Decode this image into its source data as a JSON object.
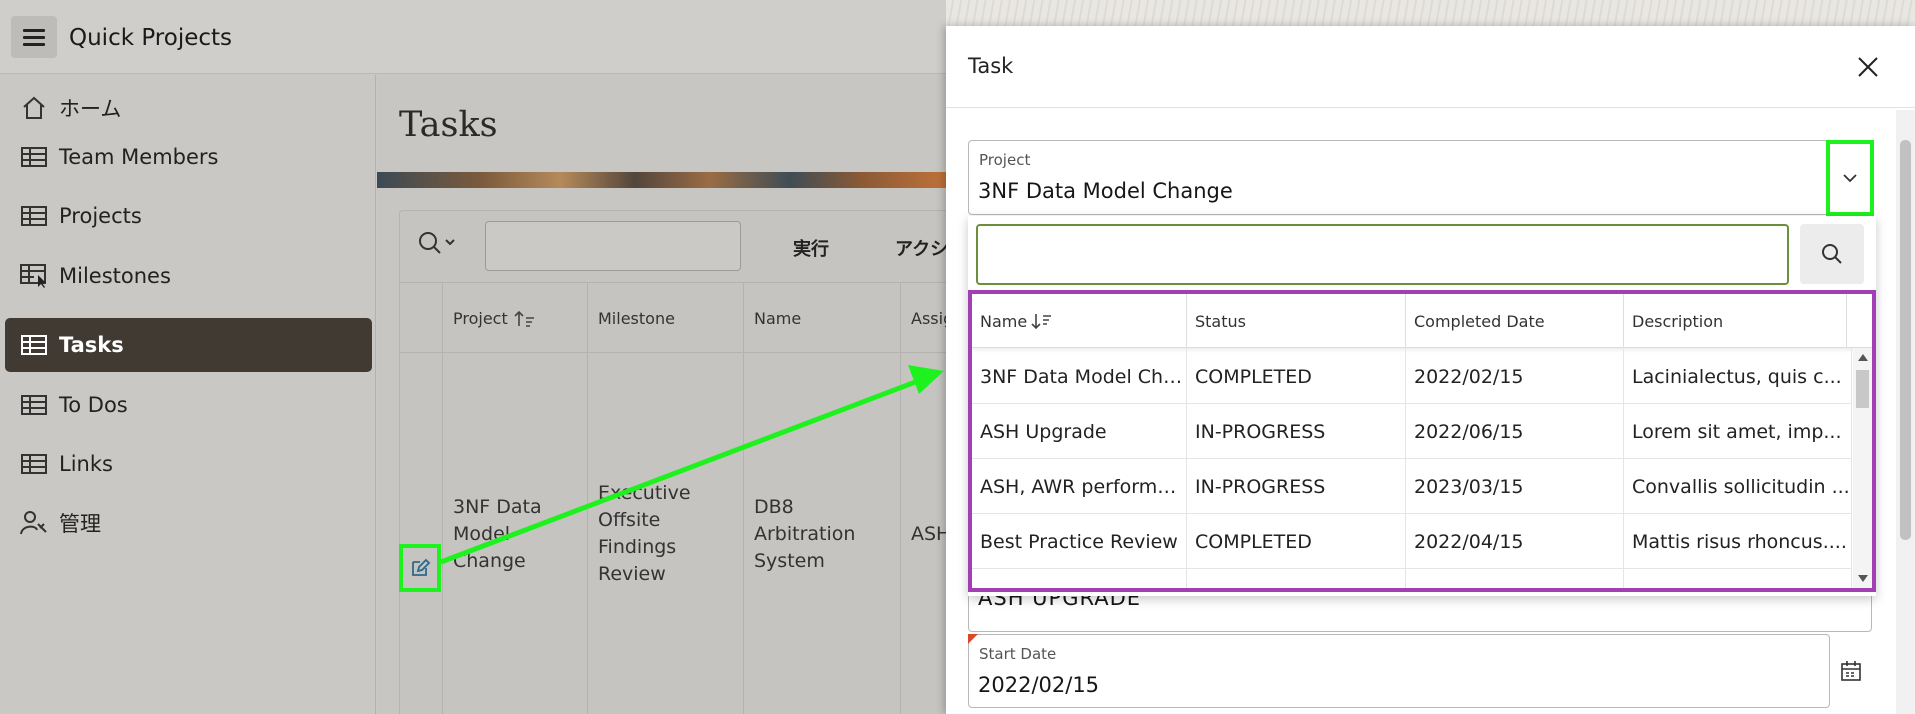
{
  "app": {
    "title": "Quick Projects"
  },
  "sidebar": {
    "items": [
      {
        "label": "ホーム",
        "icon": "home-icon"
      },
      {
        "label": "Team Members",
        "icon": "table-icon"
      },
      {
        "label": "Projects",
        "icon": "table-icon"
      },
      {
        "label": "Milestones",
        "icon": "table-icon"
      },
      {
        "label": "Tasks",
        "icon": "table-icon",
        "active": true
      },
      {
        "label": "To Dos",
        "icon": "table-icon"
      },
      {
        "label": "Links",
        "icon": "table-icon"
      },
      {
        "label": "管理",
        "icon": "user-wrench-icon"
      }
    ]
  },
  "main": {
    "title": "Tasks",
    "toolbar": {
      "go_label": "実行",
      "actions_label": "アクシ"
    },
    "grid": {
      "headers": [
        "Project",
        "Milestone",
        "Name",
        "Assig"
      ],
      "row": {
        "project": "3NF Data Model Change",
        "milestone": "Executive Offsite Findings Review",
        "name": "DB8 Arbitration System",
        "assignee": "ASH"
      }
    }
  },
  "dialog": {
    "title": "Task",
    "project_field": {
      "label": "Project",
      "value": "3NF Data Model Change"
    },
    "lov": {
      "search_value": "",
      "headers": [
        "Name",
        "Status",
        "Completed Date",
        "Description"
      ],
      "rows": [
        [
          "3NF Data Model Cha...",
          "COMPLETED",
          "2022/02/15",
          "Lacinialectus, quis c..."
        ],
        [
          "ASH Upgrade",
          "IN-PROGRESS",
          "2022/06/15",
          "Lorem sit amet, imp..."
        ],
        [
          "ASH, AWR performa...",
          "IN-PROGRESS",
          "2023/03/15",
          "Convallis sollicitudin ..."
        ],
        [
          "Best Practice Review",
          "COMPLETED",
          "2022/04/15",
          "Mattis risus rhoncus...."
        ]
      ]
    },
    "peek_field_value": "ASH UPGRADE",
    "start_date": {
      "label": "Start Date",
      "value": "2022/02/15"
    }
  },
  "colors": {
    "highlight_green": "#1ef21e",
    "highlight_purple": "#a23fb5",
    "nav_active": "#403a33"
  }
}
